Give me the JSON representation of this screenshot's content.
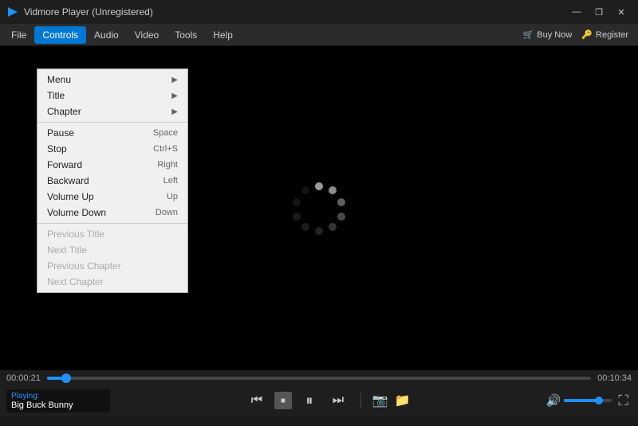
{
  "titleBar": {
    "title": "Vidmore Player (Unregistered)",
    "iconColor": "#1e90ff"
  },
  "windowControls": {
    "minimize": "—",
    "restore": "❐",
    "close": "✕"
  },
  "menuBar": {
    "items": [
      "File",
      "Controls",
      "Audio",
      "Video",
      "Tools",
      "Help"
    ],
    "activeItem": "Controls",
    "buyNow": "Buy Now",
    "register": "Register"
  },
  "controlsMenu": {
    "sections": [
      {
        "items": [
          {
            "label": "Menu",
            "shortcut": "",
            "hasArrow": true,
            "disabled": false
          },
          {
            "label": "Title",
            "shortcut": "",
            "hasArrow": true,
            "disabled": false
          },
          {
            "label": "Chapter",
            "shortcut": "",
            "hasArrow": true,
            "disabled": false
          }
        ]
      },
      {
        "items": [
          {
            "label": "Pause",
            "shortcut": "Space",
            "hasArrow": false,
            "disabled": false
          },
          {
            "label": "Stop",
            "shortcut": "Ctrl+S",
            "hasArrow": false,
            "disabled": false
          },
          {
            "label": "Forward",
            "shortcut": "Right",
            "hasArrow": false,
            "disabled": false
          },
          {
            "label": "Backward",
            "shortcut": "Left",
            "hasArrow": false,
            "disabled": false
          },
          {
            "label": "Volume Up",
            "shortcut": "Up",
            "hasArrow": false,
            "disabled": false
          },
          {
            "label": "Volume Down",
            "shortcut": "Down",
            "hasArrow": false,
            "disabled": false
          }
        ]
      },
      {
        "items": [
          {
            "label": "Previous Title",
            "shortcut": "",
            "hasArrow": false,
            "disabled": true
          },
          {
            "label": "Next Title",
            "shortcut": "",
            "hasArrow": false,
            "disabled": true
          },
          {
            "label": "Previous Chapter",
            "shortcut": "",
            "hasArrow": false,
            "disabled": true
          },
          {
            "label": "Next Chapter",
            "shortcut": "",
            "hasArrow": false,
            "disabled": true
          }
        ]
      }
    ]
  },
  "player": {
    "currentTime": "00:00:21",
    "totalTime": "00:10:34",
    "progressPercent": 3.6,
    "volumePercent": 72,
    "nowPlayingLabel": "Playing:",
    "nowPlayingTitle": "Big Buck Bunny"
  },
  "controls": {
    "rewind": "⏮",
    "stop": "■",
    "pause": "⏸",
    "forward": "⏭",
    "screenshot": "📷",
    "folder": "📁",
    "volume": "🔊",
    "fullscreen": "⛶"
  }
}
